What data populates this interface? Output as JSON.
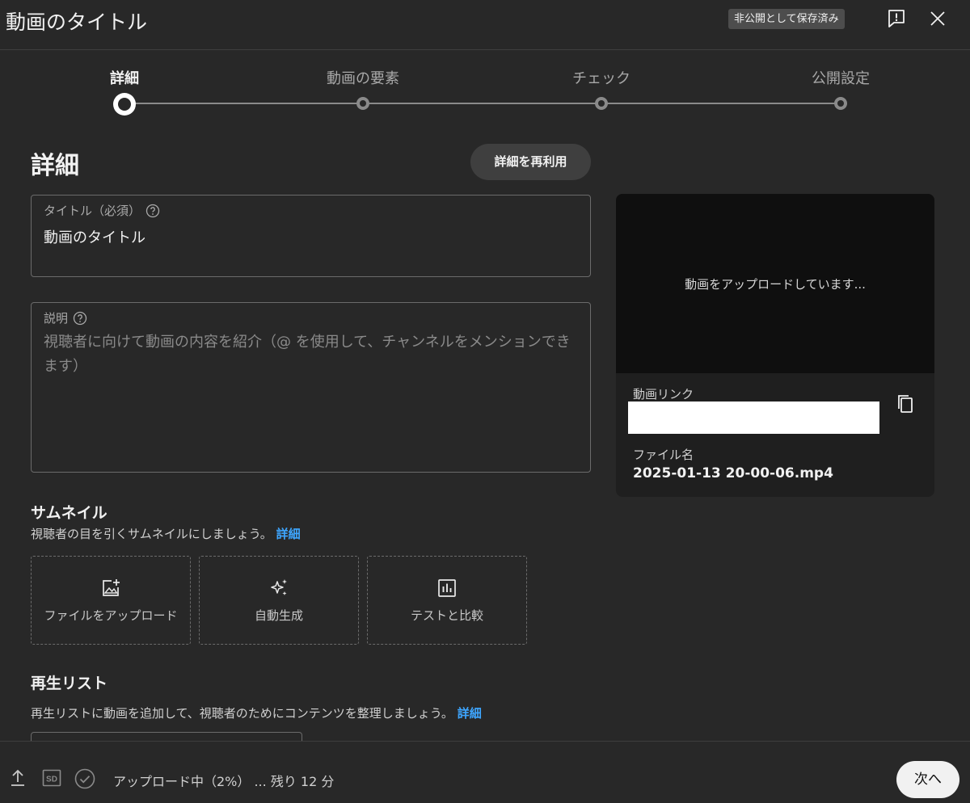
{
  "header": {
    "title": "動画のタイトル",
    "saved_badge": "非公開として保存済み",
    "feedback_icon": "feedback-icon",
    "close_icon": "close-icon"
  },
  "stepper": {
    "steps": [
      {
        "label": "詳細",
        "active": true
      },
      {
        "label": "動画の要素",
        "active": false
      },
      {
        "label": "チェック",
        "active": false
      },
      {
        "label": "公開設定",
        "active": false
      }
    ]
  },
  "details": {
    "heading": "詳細",
    "reuse_button": "詳細を再利用",
    "title_field": {
      "label": "タイトル（必須）",
      "value": "動画のタイトル"
    },
    "description_field": {
      "label": "説明",
      "placeholder": "視聴者に向けて動画の内容を紹介（@ を使用して、チャンネルをメンションできます）"
    }
  },
  "preview": {
    "uploading_message": "動画をアップロードしています...",
    "link_label": "動画リンク",
    "copy_icon": "copy-icon",
    "file_label": "ファイル名",
    "file_name": "2025-01-13 20-00-06.mp4"
  },
  "thumbnail": {
    "heading": "サムネイル",
    "description": "視聴者の目を引くサムネイルにしましょう。",
    "learn_more": "詳細",
    "options": [
      {
        "label": "ファイルをアップロード",
        "icon": "add-photo-icon"
      },
      {
        "label": "自動生成",
        "icon": "sparkle-icon"
      },
      {
        "label": "テストと比較",
        "icon": "bar-chart-icon"
      }
    ]
  },
  "playlist": {
    "heading": "再生リスト",
    "description": "再生リストに動画を追加して、視聴者のためにコンテンツを整理しましょう。",
    "learn_more": "詳細"
  },
  "footer": {
    "icons": [
      "upload-icon",
      "sd-icon",
      "check-circle-icon"
    ],
    "status": "アップロード中（2%） ... 残り 12 分",
    "next_button": "次へ"
  },
  "colors": {
    "background": "#282828",
    "link": "#3ea6ff",
    "video_bg": "#0f0f0f"
  }
}
